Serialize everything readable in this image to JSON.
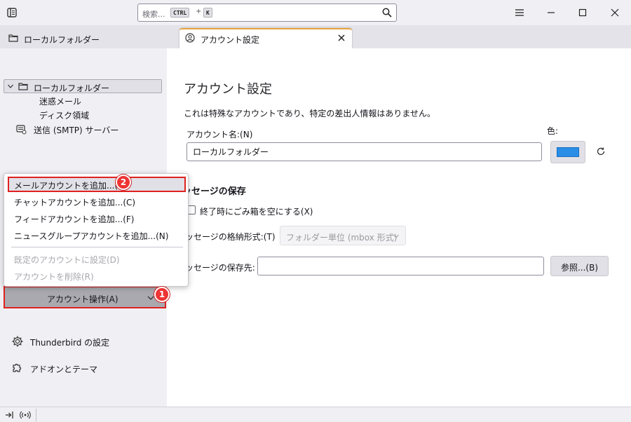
{
  "titlebar": {
    "search_placeholder": "検索...",
    "shortcut_key1": "CTRL",
    "shortcut_plus": "+",
    "shortcut_key2": "K"
  },
  "tabs": [
    {
      "label": "ローカルフォルダー",
      "icon": "folder-icon",
      "active": false
    },
    {
      "label": "アカウント設定",
      "icon": "account-settings-icon",
      "active": true
    }
  ],
  "sidebar": {
    "root_folder": "ローカルフォルダー",
    "children": [
      "迷惑メール",
      "ディスク領域"
    ],
    "smtp_label": "送信 (SMTP) サーバー",
    "account_actions_label": "アカウント操作(A)",
    "settings_label": "Thunderbird の設定",
    "addons_label": "アドオンとテーマ"
  },
  "main": {
    "title": "アカウント設定",
    "description": "これは特殊なアカウントであり、特定の差出人情報はありません。",
    "account_name_label": "アカウント名:(N)",
    "account_name_value": "ローカルフォルダー",
    "color_label": "色:",
    "account_color": "#2a8de6",
    "section_title": "ッセージの保存",
    "empty_trash_label": "終了時にごみ箱を空にする(X)",
    "empty_trash_checked": false,
    "store_type_label": "ッセージの格納形式:(T)",
    "store_type_value": "フォルダー単位 (mbox 形式)",
    "local_dir_label": "ッセージの保存先:",
    "local_dir_value": "",
    "browse_label": "参照...(B)"
  },
  "popup_menu": {
    "items": [
      {
        "label": "メールアカウントを追加...(A)",
        "enabled": true
      },
      {
        "label": "チャットアカウントを追加...(C)",
        "enabled": true
      },
      {
        "label": "フィードアカウントを追加...(F)",
        "enabled": true
      },
      {
        "label": "ニュースグループアカウントを追加...(N)",
        "enabled": true
      },
      {
        "label": "既定のアカウントに設定(D)",
        "enabled": false
      },
      {
        "label": "アカウントを削除(R)",
        "enabled": false
      }
    ]
  },
  "annotations": {
    "badge1": "1",
    "badge2": "2",
    "highlight_color": "#e02020"
  }
}
